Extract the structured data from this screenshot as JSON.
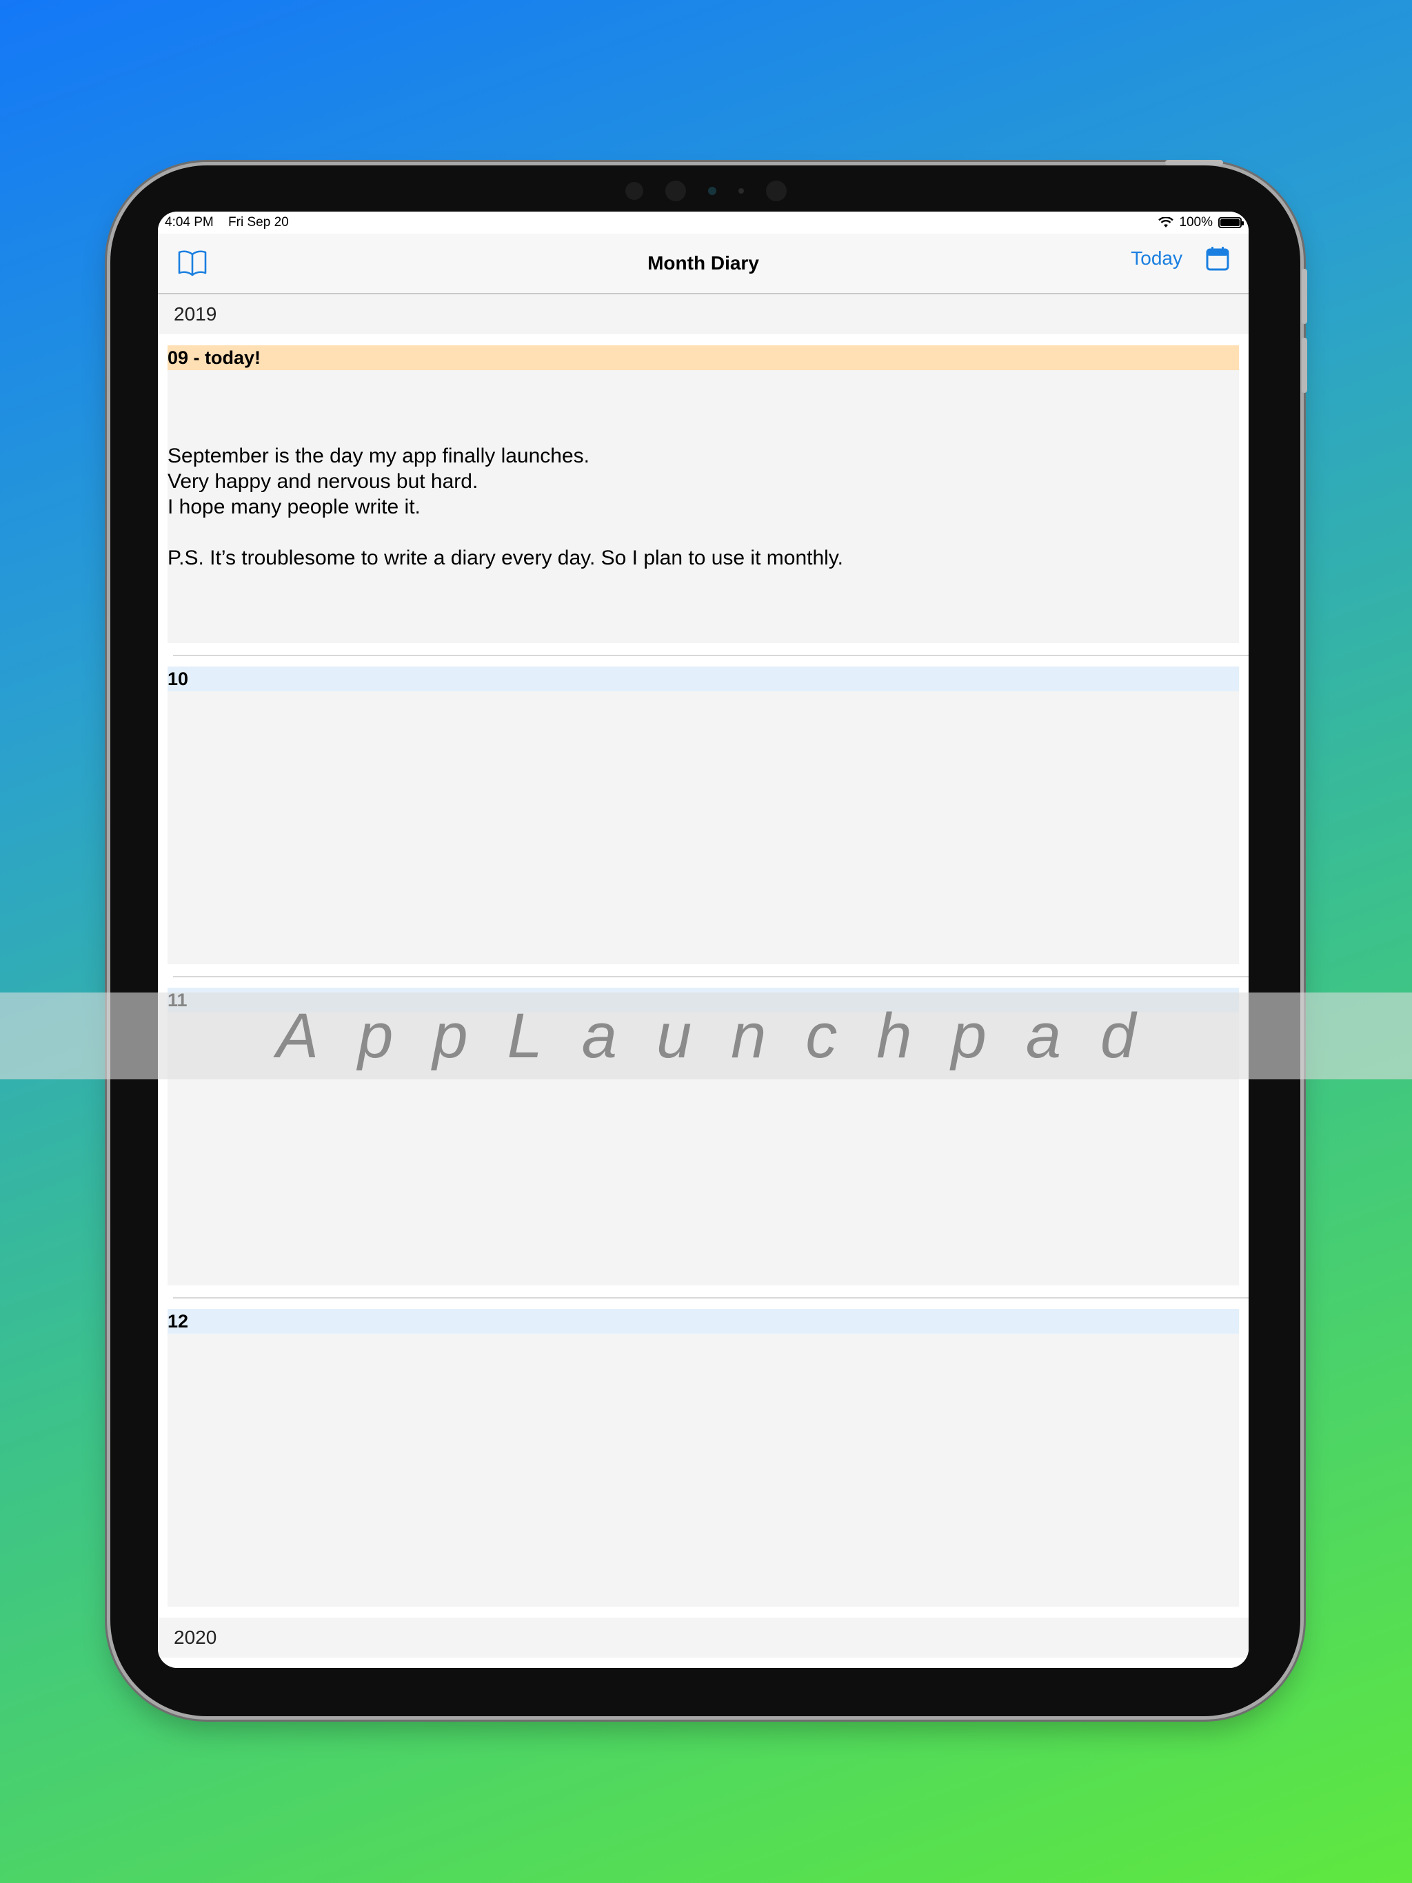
{
  "status_bar": {
    "time": "4:04 PM",
    "date": "Fri Sep 20",
    "battery": "100%"
  },
  "nav": {
    "title": "Month Diary",
    "today_label": "Today"
  },
  "years": [
    {
      "year": "2019",
      "months": [
        {
          "label": "09 - today!",
          "text": "September is the day my app finally launches.\nVery happy and nervous but hard.\nI hope many people write it.\n\nP.S. It’s troublesome to write a diary every day. So I plan to use it monthly."
        },
        {
          "label": "10",
          "text": ""
        },
        {
          "label": "11",
          "text": ""
        },
        {
          "label": "12",
          "text": ""
        }
      ]
    },
    {
      "year": "2020"
    }
  ],
  "watermark": "AppLaunchpad",
  "colors": {
    "accent": "#1a7fe0",
    "today_highlight": "#ffdfb4",
    "month_highlight": "#e3f0fb",
    "card_background": "#f4f4f4"
  }
}
